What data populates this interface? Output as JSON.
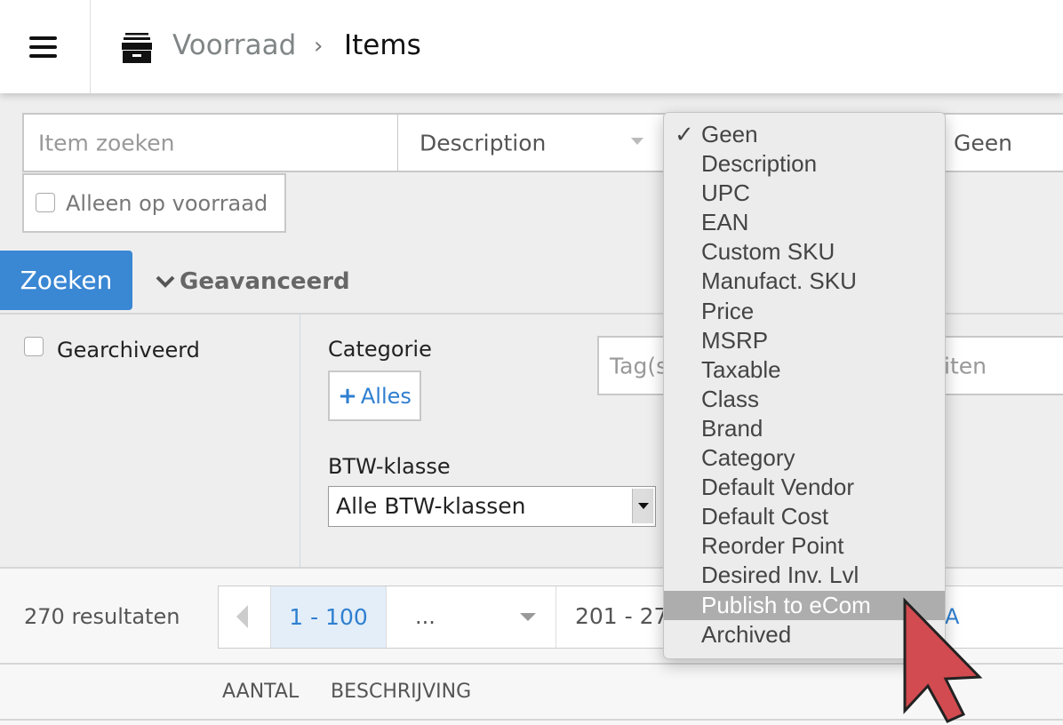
{
  "header": {
    "breadcrumb_parent": "Voorraad",
    "separator": "›",
    "title": "Items"
  },
  "search": {
    "placeholder": "Item zoeken",
    "field_select": "Description",
    "second_select": "Geen",
    "in_stock_label": "Alleen op voorraad",
    "search_button": "Zoeken",
    "advanced_label": "Geavanceerd"
  },
  "advanced": {
    "archived_label": "Gearchiveerd",
    "category_label": "Categorie",
    "category_button": "Alles",
    "tags_placeholder_visible_start": "Tag(s",
    "tags_placeholder_visible_end": "iten",
    "tax_label": "BTW-klasse",
    "tax_select": "Alle BTW-klassen"
  },
  "results": {
    "count": "270 resultaten",
    "pages": [
      "1 - 100",
      "...",
      "201 - 27"
    ],
    "current_page": "1 - 100",
    "trailing_link": "A"
  },
  "table": {
    "columns": [
      "AANTAL",
      "BESCHRIJVING"
    ]
  },
  "dropdown": {
    "checkmark": "✓",
    "selected": "Geen",
    "highlighted": "Publish to eCom",
    "options": [
      "Geen",
      "Description",
      "UPC",
      "EAN",
      "Custom SKU",
      "Manufact. SKU",
      "Price",
      "MSRP",
      "Taxable",
      "Class",
      "Brand",
      "Category",
      "Default Vendor",
      "Default Cost",
      "Reorder Point",
      "Desired Inv. Lvl",
      "Publish to eCom",
      "Archived"
    ]
  },
  "colors": {
    "accent": "#3a87d4",
    "cursor": "#d24b50",
    "page_active_bg": "#e3eef9",
    "link": "#2f7fd0"
  }
}
